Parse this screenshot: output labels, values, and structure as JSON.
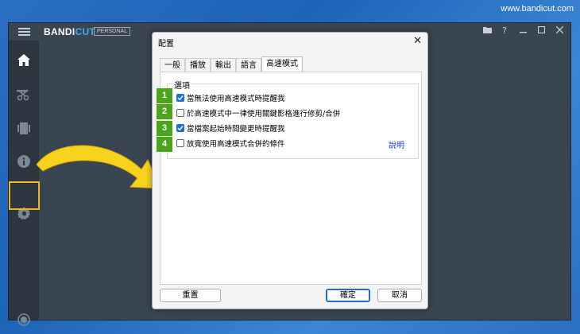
{
  "watermark": "www.bandicut.com",
  "app": {
    "brand_a": "BANDI",
    "brand_b": "CUT",
    "edition": "PERSONAL",
    "titlebar_icons": [
      "folder-icon",
      "help-icon",
      "minimize-icon",
      "maximize-icon",
      "close-icon"
    ],
    "help_glyph": "?",
    "sidebar": [
      "home-icon",
      "cut-icon",
      "encode-icon",
      "info-icon",
      "gear-icon",
      "record-icon"
    ]
  },
  "dialog": {
    "title": "配置",
    "tabs": [
      "一般",
      "播放",
      "輸出",
      "語言",
      "高速模式"
    ],
    "active_tab": 4,
    "group_label": "選項",
    "options": [
      {
        "label": "當無法使用高速模式時提醒我",
        "checked": true
      },
      {
        "label": "於高速模式中一律使用關鍵影格進行修剪/合併",
        "checked": false
      },
      {
        "label": "當檔案起始時間變更時提醒我",
        "checked": true
      },
      {
        "label": "放寬使用高速模式合併的條件",
        "checked": false
      }
    ],
    "help_link": "說明",
    "buttons": {
      "reset": "重置",
      "ok": "確定",
      "cancel": "取消"
    }
  },
  "callouts": [
    "1",
    "2",
    "3",
    "4"
  ],
  "colors": {
    "callout": "#4aa51c",
    "highlight": "#f5b31e",
    "arrow": "#f7d21f",
    "checkbox": "#1f6fd0",
    "brand_accent": "#39b0f0"
  }
}
